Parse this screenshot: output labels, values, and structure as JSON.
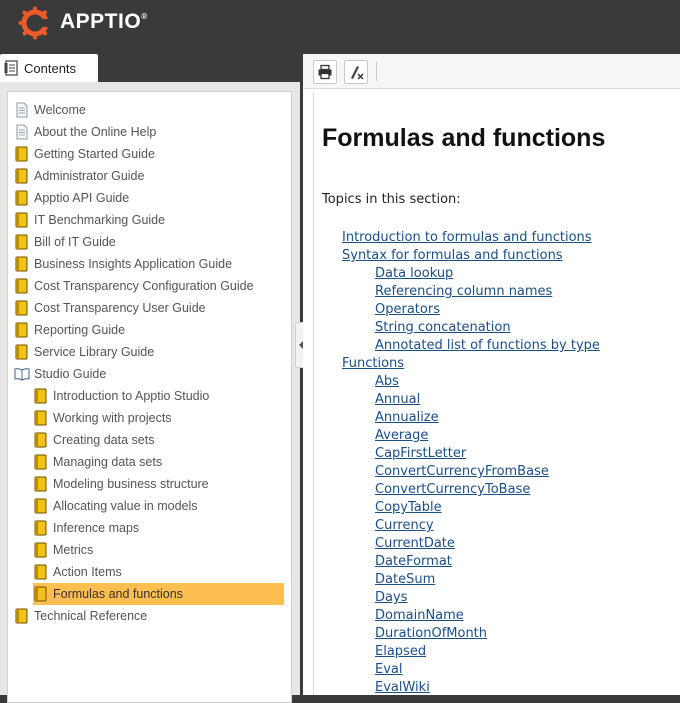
{
  "brand": {
    "name": "APPTIO",
    "reg": "®"
  },
  "tabs": {
    "contents": "Contents"
  },
  "toc": [
    {
      "label": "Welcome",
      "type": "page",
      "level": 0
    },
    {
      "label": "About the Online Help",
      "type": "page",
      "level": 0
    },
    {
      "label": "Getting Started Guide",
      "type": "book",
      "level": 0
    },
    {
      "label": "Administrator Guide",
      "type": "book",
      "level": 0
    },
    {
      "label": "Apptio API Guide",
      "type": "book",
      "level": 0
    },
    {
      "label": "IT Benchmarking Guide",
      "type": "book",
      "level": 0
    },
    {
      "label": "Bill of IT Guide",
      "type": "book",
      "level": 0
    },
    {
      "label": "Business Insights Application Guide",
      "type": "book",
      "level": 0
    },
    {
      "label": "Cost Transparency Configuration Guide",
      "type": "book",
      "level": 0
    },
    {
      "label": "Cost Transparency User Guide",
      "type": "book",
      "level": 0
    },
    {
      "label": "Reporting Guide",
      "type": "book",
      "level": 0
    },
    {
      "label": "Service Library Guide",
      "type": "book",
      "level": 0
    },
    {
      "label": "Studio Guide",
      "type": "open-book",
      "level": 0
    },
    {
      "label": "Introduction to Apptio Studio",
      "type": "book",
      "level": 1
    },
    {
      "label": "Working with projects",
      "type": "book",
      "level": 1
    },
    {
      "label": "Creating data sets",
      "type": "book",
      "level": 1
    },
    {
      "label": "Managing data sets",
      "type": "book",
      "level": 1
    },
    {
      "label": "Modeling business structure",
      "type": "book",
      "level": 1
    },
    {
      "label": "Allocating value in models",
      "type": "book",
      "level": 1
    },
    {
      "label": "Inference maps",
      "type": "book",
      "level": 1
    },
    {
      "label": "Metrics",
      "type": "book",
      "level": 1
    },
    {
      "label": "Action Items",
      "type": "book",
      "level": 1
    },
    {
      "label": "Formulas and functions",
      "type": "book",
      "level": 1,
      "selected": true
    },
    {
      "label": "Technical Reference",
      "type": "book",
      "level": 0
    }
  ],
  "toolbar": {
    "print_icon": "print-icon",
    "highlight_icon": "remove-highlight-icon"
  },
  "content": {
    "title": "Formulas and functions",
    "intro": "Topics in this section:",
    "links": [
      {
        "text": "Introduction to formulas and functions",
        "level": 0
      },
      {
        "text": "Syntax for formulas and functions",
        "level": 0
      },
      {
        "text": "Data lookup",
        "level": 1
      },
      {
        "text": "Referencing column names",
        "level": 1
      },
      {
        "text": "Operators",
        "level": 1
      },
      {
        "text": "String concatenation",
        "level": 1
      },
      {
        "text": "Annotated list of functions by type",
        "level": 1
      },
      {
        "text": "Functions",
        "level": 0
      },
      {
        "text": "Abs",
        "level": 1
      },
      {
        "text": "Annual",
        "level": 1
      },
      {
        "text": "Annualize",
        "level": 1
      },
      {
        "text": "Average",
        "level": 1
      },
      {
        "text": "CapFirstLetter",
        "level": 1
      },
      {
        "text": "ConvertCurrencyFromBase",
        "level": 1
      },
      {
        "text": "ConvertCurrencyToBase",
        "level": 1
      },
      {
        "text": "CopyTable",
        "level": 1
      },
      {
        "text": "Currency",
        "level": 1
      },
      {
        "text": "CurrentDate",
        "level": 1
      },
      {
        "text": "DateFormat",
        "level": 1
      },
      {
        "text": "DateSum",
        "level": 1
      },
      {
        "text": "Days",
        "level": 1
      },
      {
        "text": "DomainName",
        "level": 1
      },
      {
        "text": "DurationOfMonth",
        "level": 1
      },
      {
        "text": "Elapsed",
        "level": 1
      },
      {
        "text": "Eval",
        "level": 1
      },
      {
        "text": "EvalWiki",
        "level": 1
      }
    ]
  },
  "colors": {
    "header": "#3a3a3a",
    "selected": "#ffbe50",
    "link": "#1a4f87",
    "logo": "#f05a28"
  }
}
